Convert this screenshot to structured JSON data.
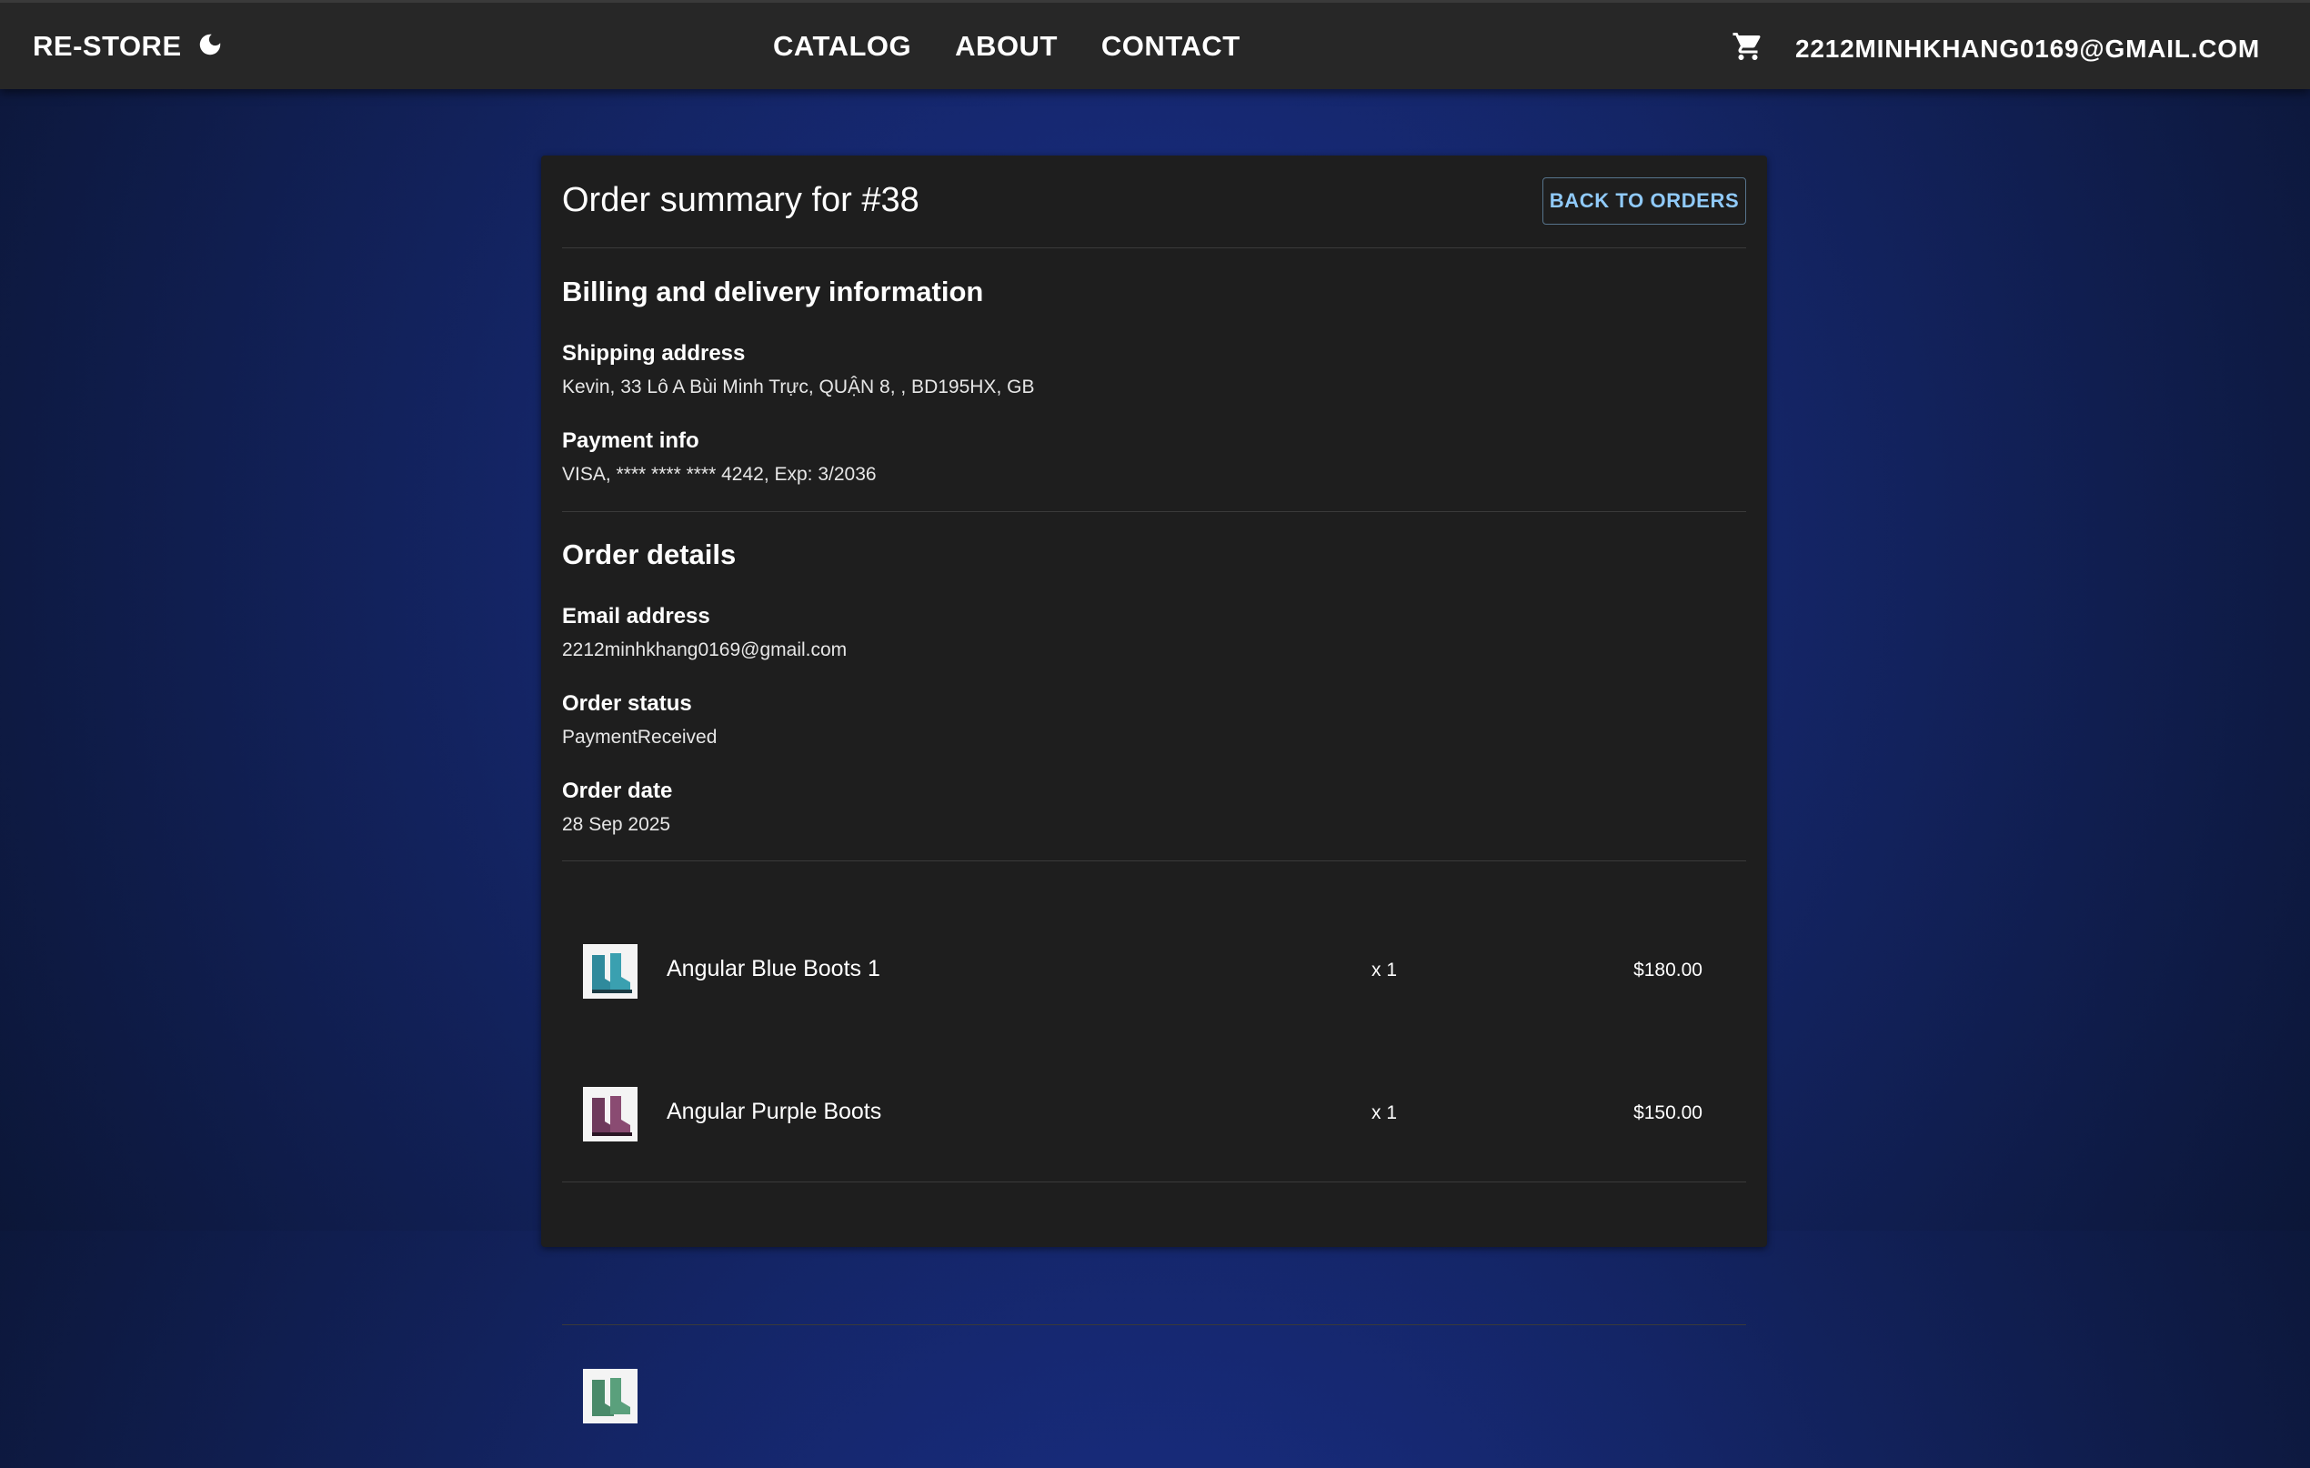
{
  "navbar": {
    "brand": "RE-STORE",
    "links": [
      "CATALOG",
      "ABOUT",
      "CONTACT"
    ],
    "user_email": "2212MINHKHANG0169@GMAIL.COM"
  },
  "order": {
    "title": "Order summary for #38",
    "back_label": "BACK TO ORDERS",
    "billing_heading": "Billing and delivery information",
    "shipping_label": "Shipping address",
    "shipping_value": "Kevin, 33 Lô A Bùi Minh Trực, QUẬN 8, , BD195HX, GB",
    "payment_label": "Payment info",
    "payment_value": "VISA, **** **** **** 4242, Exp: 3/2036",
    "details_heading": "Order details",
    "email_label": "Email address",
    "email_value": "2212minhkhang0169@gmail.com",
    "status_label": "Order status",
    "status_value": "PaymentReceived",
    "date_label": "Order date",
    "date_value": "28 Sep 2025"
  },
  "items": [
    {
      "name": "Angular Blue Boots 1",
      "qty": "x 1",
      "price": "$180.00",
      "color": "#2f8a9c"
    },
    {
      "name": "Angular Purple Boots",
      "qty": "x 1",
      "price": "$150.00",
      "color": "#6e3a5c"
    },
    {
      "name": "",
      "qty": "",
      "price": "",
      "color": "#4a8a6a"
    }
  ],
  "colors": {
    "accent": "#90caf9",
    "card": "#1e1e1e",
    "navbar": "#272727"
  }
}
